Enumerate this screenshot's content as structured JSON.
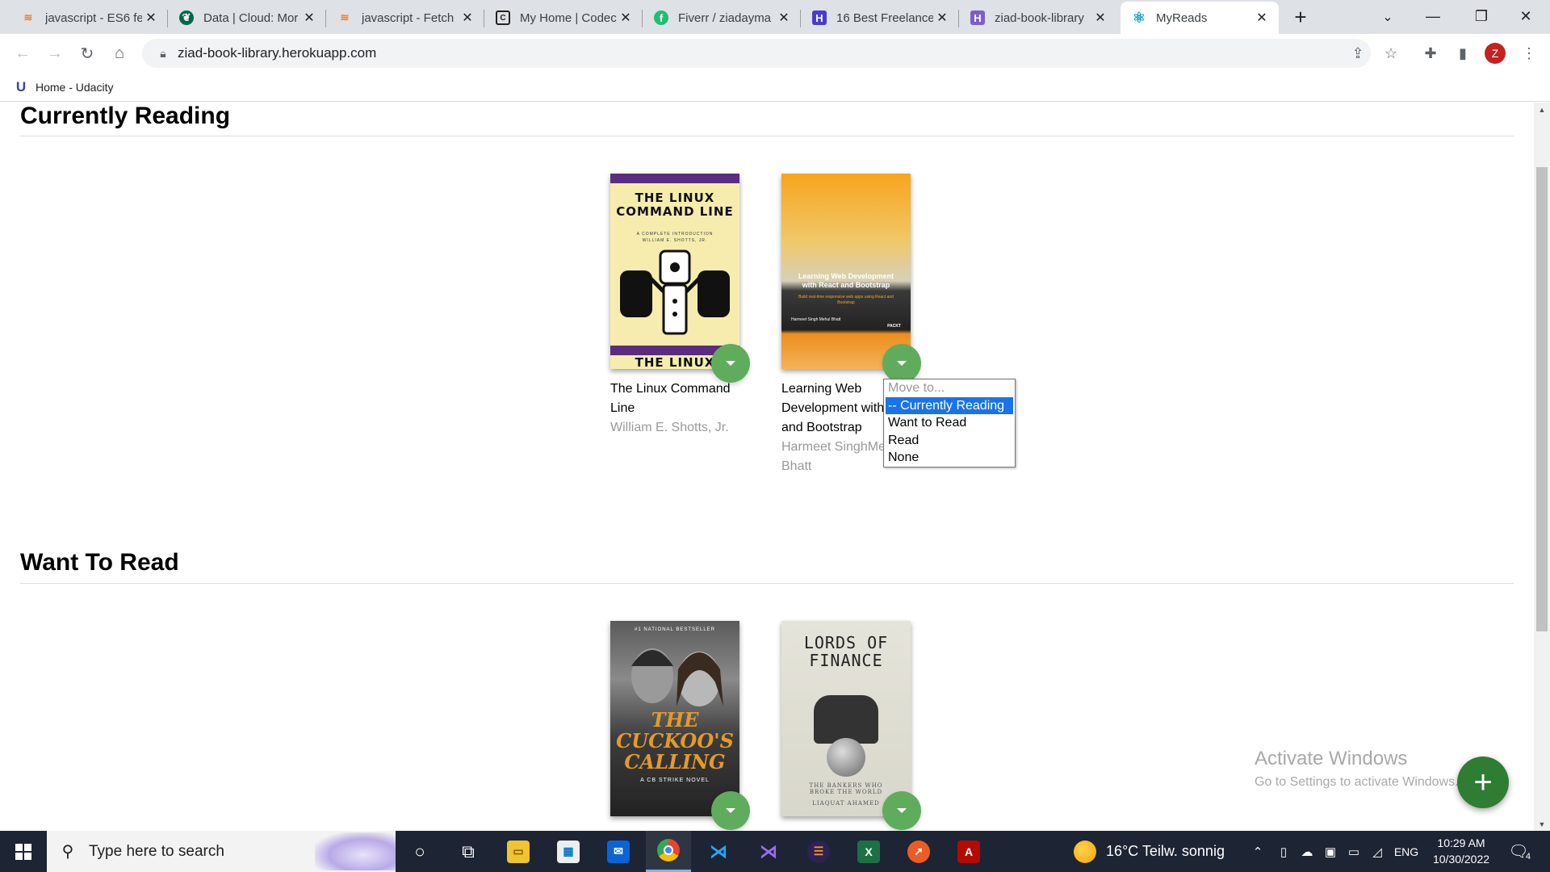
{
  "browser": {
    "tabs": [
      {
        "title": "javascript - ES6 fe",
        "icon": "stackoverflow-icon"
      },
      {
        "title": "Data | Cloud: Mor",
        "icon": "mongodb-icon"
      },
      {
        "title": "javascript - Fetch",
        "icon": "stackoverflow-icon"
      },
      {
        "title": "My Home | Codec",
        "icon": "codecademy-icon"
      },
      {
        "title": "Fiverr / ziadayma",
        "icon": "fiverr-icon"
      },
      {
        "title": "16 Best Freelance",
        "icon": "bookmark-h-icon"
      },
      {
        "title": "ziad-book-library",
        "icon": "heroku-icon"
      },
      {
        "title": "MyReads",
        "icon": "react-icon"
      }
    ],
    "url": "ziad-book-library.herokuapp.com",
    "profile_initial": "Z",
    "bookmark_label": "Home - Udacity"
  },
  "shelves": {
    "currently_reading": {
      "title": "Currently Reading",
      "books": [
        {
          "title": "The Linux Command Line",
          "authors": "William E. Shotts, Jr.",
          "cover_title": "THE LINUX COMMAND LINE",
          "cover_subtitle": "A COMPLETE INTRODUCTION",
          "cover_author": "WILLIAM E. SHOTTS, JR.",
          "cover_bottom": "THE LINUX"
        },
        {
          "title": "Learning Web Development with React and Bootstrap",
          "authors": "Harmeet Singh Mehul Bhatt",
          "cover_title": "Learning Web Development with React and Bootstrap",
          "cover_subtitle": "Build real-time responsive web apps using React and Bootstrap",
          "cover_authors": "Harmeet Singh  Mehul Bhatt",
          "cover_publisher": "PACKT"
        }
      ]
    },
    "want_to_read": {
      "title": "Want To Read",
      "books": [
        {
          "cover_title": "THE CUCKOO'S CALLING",
          "cover_top": "#1 NATIONAL BESTSELLER",
          "cover_subtitle": "A CB STRIKE NOVEL"
        },
        {
          "cover_title": "LORDS OF FINANCE",
          "cover_subtitle": "THE BANKERS WHO BROKE THE WORLD",
          "cover_author": "LIAQUAT AHAMED"
        }
      ]
    }
  },
  "title_line_2_visible": {
    "linux": [
      "The Linux Command",
      "Line"
    ],
    "react": [
      "Learning Web",
      "Development with",
      "and Bootstrap"
    ]
  },
  "authors_lines": {
    "react": [
      "Harmeet SinghMe",
      "Bhatt"
    ]
  },
  "shelf_dropdown": {
    "options": [
      {
        "label": "Move to...",
        "state": "disabled"
      },
      {
        "label": "-- Currently Reading",
        "state": "selected"
      },
      {
        "label": "Want to Read",
        "state": "normal"
      },
      {
        "label": "Read",
        "state": "normal"
      },
      {
        "label": "None",
        "state": "normal"
      }
    ]
  },
  "add_button_label": "+",
  "watermark": {
    "line1": "Activate Windows",
    "line2": "Go to Settings to activate Windows."
  },
  "taskbar": {
    "search_placeholder": "Type here to search",
    "weather": "16°C  Teilw. sonnig",
    "language": "ENG",
    "time": "10:29 AM",
    "date": "10/30/2022",
    "notifications": "4"
  },
  "colors": {
    "changer_green": "#60ac5d",
    "add_fab_green": "#2e7d32",
    "dropdown_highlight": "#1a73e8",
    "taskbar_bg": "#1d2433"
  }
}
